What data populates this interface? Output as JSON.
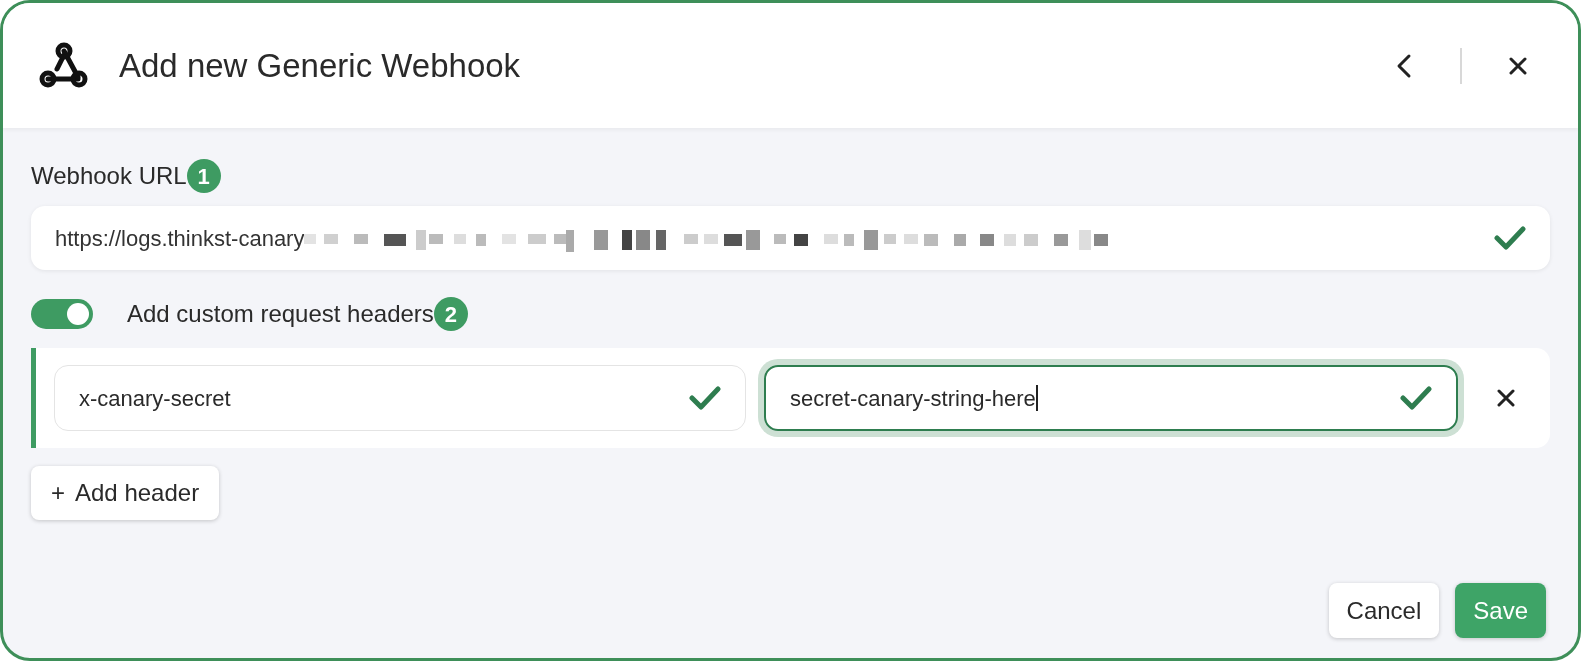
{
  "dialog": {
    "title": "Add new Generic Webhook"
  },
  "url_field": {
    "label": "Webhook URL",
    "badge": "1",
    "value": "https://logs.thinkst-canary",
    "redacted": true,
    "valid": true
  },
  "custom_headers": {
    "label": "Add custom request headers",
    "badge": "2",
    "on": true
  },
  "headers": [
    {
      "name": "x-canary-secret",
      "name_valid": true,
      "value": "secret-canary-string-here",
      "value_valid": true,
      "value_focused": true
    }
  ],
  "add_header_button": {
    "icon": "+",
    "label": "Add header"
  },
  "buttons": [
    {
      "label": "Cancel",
      "kind": "secondary"
    },
    {
      "label": "Save",
      "kind": "primary"
    }
  ]
}
